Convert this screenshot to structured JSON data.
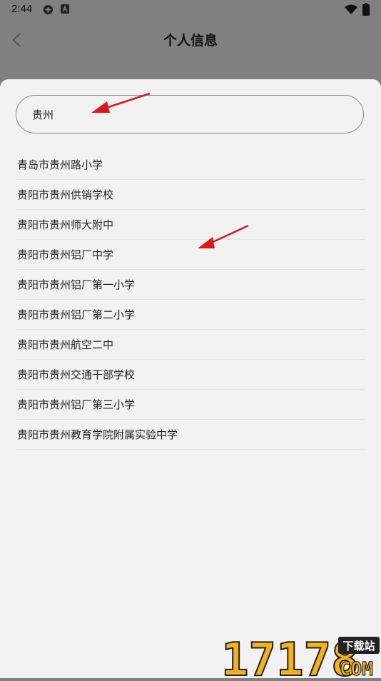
{
  "status_bar": {
    "time": "2:44"
  },
  "app_bar": {
    "title": "个人信息"
  },
  "search": {
    "value": "贵州"
  },
  "results": [
    "青岛市贵州路小学",
    "贵阳市贵州供销学校",
    "贵阳市贵州师大附中",
    "贵阳市贵州铝厂中学",
    "贵阳市贵州铝厂第一小学",
    "贵阳市贵州铝厂第二小学",
    "贵阳市贵州航空二中",
    "贵阳市贵州交通干部学校",
    "贵阳市贵州铝厂第三小学",
    "贵阳市贵州教育学院附属实验中学"
  ],
  "watermark": {
    "number": "17178",
    "badge": "下载站",
    "domain": "COM"
  },
  "colors": {
    "backdrop": "#808080",
    "sheet": "#f2f2f2",
    "annotation_arrow": "#d91a1a",
    "watermark_orange": "#f3b21b"
  }
}
